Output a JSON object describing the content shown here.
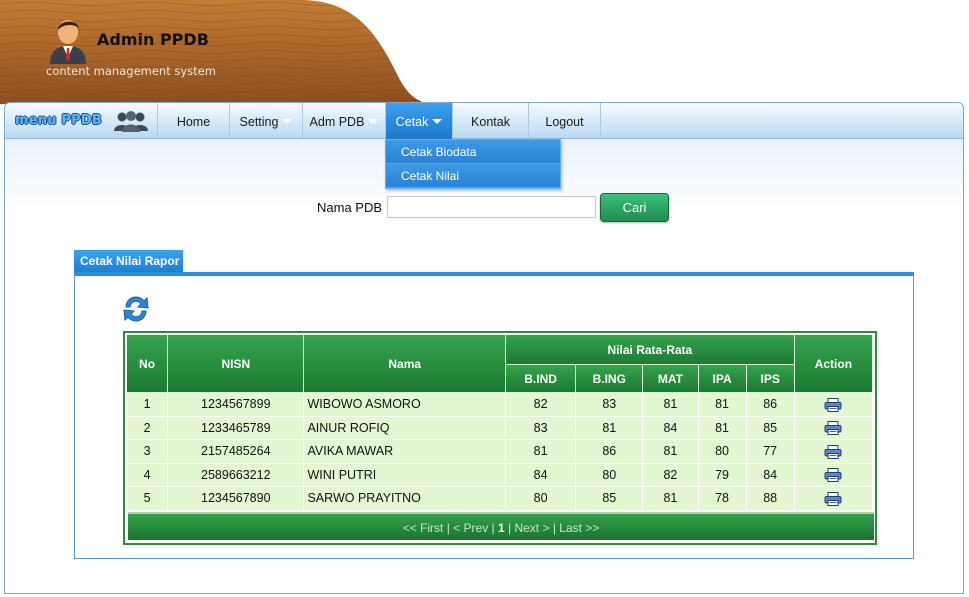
{
  "header": {
    "title": "Admin PPDB",
    "subtitle": "content management system"
  },
  "menu": {
    "brand": "menu PPDB",
    "items": [
      {
        "label": "Home",
        "has_dropdown": false
      },
      {
        "label": "Setting",
        "has_dropdown": true
      },
      {
        "label": "Adm PDB",
        "has_dropdown": true
      },
      {
        "label": "Cetak",
        "has_dropdown": true,
        "active": true
      },
      {
        "label": "Kontak",
        "has_dropdown": false
      },
      {
        "label": "Logout",
        "has_dropdown": false
      }
    ],
    "dropdown": [
      "Cetak Biodata",
      "Cetak Nilai"
    ]
  },
  "search": {
    "label": "Nama PDB",
    "value": "",
    "button": "Cari"
  },
  "panel": {
    "tab_title": "Cetak Nilai Rapor"
  },
  "table": {
    "headers": {
      "no": "No",
      "nisn": "NISN",
      "nama": "Nama",
      "group": "Nilai Rata-Rata",
      "bind": "B.IND",
      "bing": "B.ING",
      "mat": "MAT",
      "ipa": "IPA",
      "ips": "IPS",
      "action": "Action"
    },
    "rows": [
      {
        "no": "1",
        "nisn": "1234567899",
        "nama": "WIBOWO ASMORO",
        "bind": "82",
        "bing": "83",
        "mat": "81",
        "ipa": "81",
        "ips": "86"
      },
      {
        "no": "2",
        "nisn": "1233465789",
        "nama": "AINUR ROFIQ",
        "bind": "83",
        "bing": "81",
        "mat": "84",
        "ipa": "81",
        "ips": "85"
      },
      {
        "no": "3",
        "nisn": "2157485264",
        "nama": "AVIKA MAWAR",
        "bind": "81",
        "bing": "86",
        "mat": "81",
        "ipa": "80",
        "ips": "77"
      },
      {
        "no": "4",
        "nisn": "2589663212",
        "nama": "WINI PUTRI",
        "bind": "84",
        "bing": "80",
        "mat": "82",
        "ipa": "79",
        "ips": "84"
      },
      {
        "no": "5",
        "nisn": "1234567890",
        "nama": "SARWO PRAYITNO",
        "bind": "80",
        "bing": "85",
        "mat": "81",
        "ipa": "78",
        "ips": "88"
      }
    ],
    "action_icon": "print-icon"
  },
  "pager": {
    "first": "<< First",
    "prev": "< Prev",
    "current": "1",
    "next": "Next >",
    "last": "Last >>"
  },
  "colors": {
    "wood": "#b5702c",
    "menu_active": "#2a86d6",
    "table_header": "#1f8437",
    "table_row": "#e3f7d2",
    "button": "#25a55f"
  }
}
